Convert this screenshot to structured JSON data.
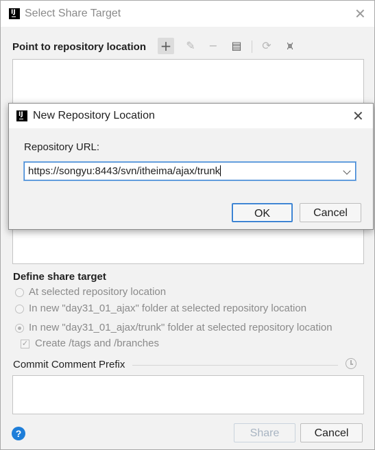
{
  "outer": {
    "title": "Select Share Target",
    "repo_label": "Point to repository location",
    "toolbar": {
      "add": "+",
      "edit": "✎",
      "remove": "−",
      "browse": "▤",
      "refresh": "⟳",
      "collapse": "⩙"
    },
    "define_label": "Define share target",
    "options": [
      "At selected repository location",
      "In new \"day31_01_ajax\" folder at selected repository location",
      "In new \"day31_01_ajax/trunk\" folder at selected repository location"
    ],
    "selected_option_index": 2,
    "checkbox_label": "Create /tags and /branches",
    "checkbox_checked": true,
    "commit_label": "Commit Comment Prefix",
    "commit_value": "",
    "share_button": "Share",
    "cancel_button": "Cancel",
    "help": "?"
  },
  "dialog": {
    "title": "New Repository Location",
    "url_label": "Repository URL:",
    "url_value": "https://songyu:8443/svn/itheima/ajax/trunk",
    "ok_button": "OK",
    "cancel_button": "Cancel"
  },
  "colors": {
    "accent": "#3d84d3",
    "help_blue": "#1e7ed9"
  }
}
